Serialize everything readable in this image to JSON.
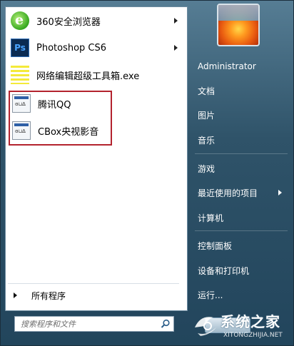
{
  "start_menu": {
    "programs": [
      {
        "label": "360安全浏览器",
        "icon": "360-browser-icon",
        "has_submenu": true
      },
      {
        "label": "Photoshop CS6",
        "icon": "photoshop-icon",
        "icon_text": "Ps",
        "has_submenu": true
      },
      {
        "label": "网络编辑超级工具箱.exe",
        "icon": "exe-icon",
        "has_submenu": false
      },
      {
        "label": "腾讯QQ",
        "icon": "application-icon",
        "has_submenu": false
      },
      {
        "label": "CBox央视影音",
        "icon": "application-icon",
        "has_submenu": false
      }
    ],
    "all_programs_label": "所有程序",
    "search": {
      "placeholder": "搜索程序和文件"
    },
    "right_items": [
      {
        "label": "Administrator"
      },
      {
        "label": "文档"
      },
      {
        "label": "图片"
      },
      {
        "label": "音乐"
      },
      {
        "label": "游戏"
      },
      {
        "label": "最近使用的项目",
        "has_submenu": true
      },
      {
        "label": "计算机"
      },
      {
        "label": "控制面板"
      },
      {
        "label": "设备和打印机"
      },
      {
        "label": "运行..."
      }
    ],
    "highlight_color": "#b3232e"
  },
  "watermark": {
    "title": "系统之家",
    "url": "XITONGZHIJIA.NET"
  }
}
